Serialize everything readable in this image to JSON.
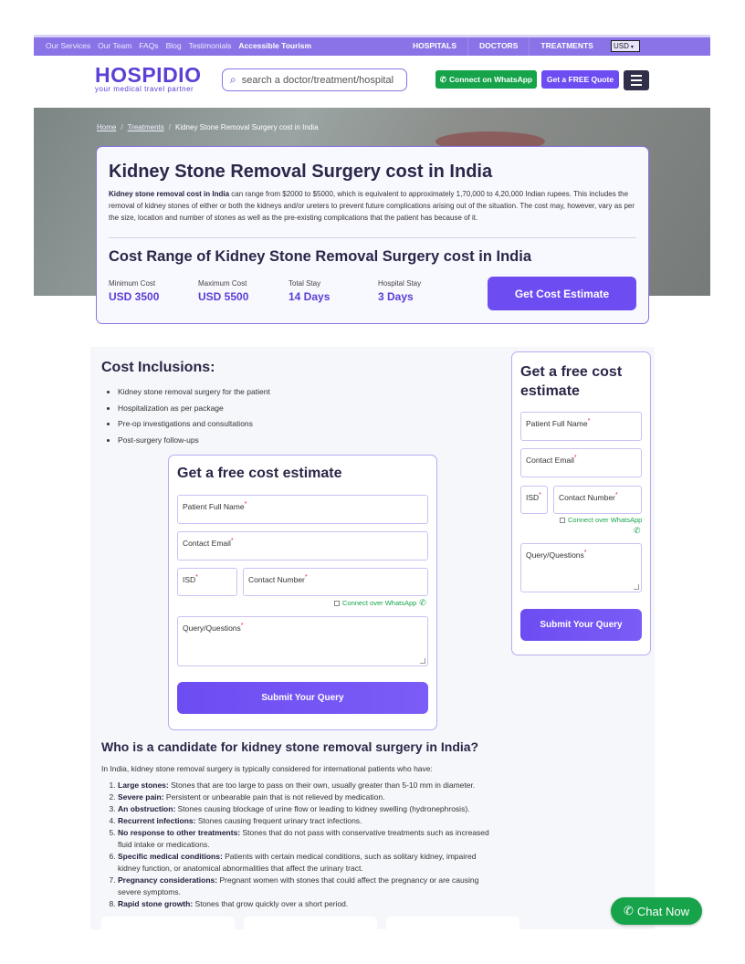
{
  "topbar": {
    "links": [
      "Our Services",
      "Our Team",
      "FAQs",
      "Blog",
      "Testimonials"
    ],
    "highlight": "Accessible Tourism",
    "menu": [
      "HOSPITALS",
      "DOCTORS",
      "TREATMENTS"
    ],
    "currency": "USD"
  },
  "header": {
    "brand": "HOSPIDIO",
    "tagline": "your medical travel partner",
    "search_placeholder": "search a doctor/treatment/hospital",
    "whatsapp_label": "Connect on WhatsApp",
    "quote_label": "Get a FREE Quote"
  },
  "breadcrumb": {
    "home": "Home",
    "treatments": "Treatments",
    "current": "Kidney Stone Removal Surgery cost in India"
  },
  "cost": {
    "title": "Kidney Stone Removal Surgery cost in India",
    "desc_bold": "Kidney stone removal cost in India",
    "desc_rest": " can range from $2000 to $5000, which is equivalent to approximately 1,70,000 to 4,20,000 Indian rupees. This includes the removal of kidney stones of either or both the kidneys and/or ureters to prevent future complications arising out of the situation. The cost may, however, vary as per the size, location and number of stones as well as the pre-existing complications that the patient has because of it.",
    "range_title": "Cost Range of Kidney Stone Removal Surgery cost in India",
    "stats": [
      {
        "label": "Minimum Cost",
        "value": "USD 3500"
      },
      {
        "label": "Maximum Cost",
        "value": "USD 5500"
      },
      {
        "label": "Total Stay",
        "value": "14 Days"
      },
      {
        "label": "Hospital Stay",
        "value": "3 Days"
      }
    ],
    "estimate_button": "Get Cost Estimate"
  },
  "inclusions": {
    "title": "Cost Inclusions:",
    "items": [
      "Kidney stone removal surgery for the patient",
      "Hospitalization as per package",
      "Pre-op investigations and consultations",
      "Post-surgery follow-ups"
    ]
  },
  "form": {
    "title": "Get a free cost estimate",
    "name": "Patient Full Name",
    "email": "Contact Email",
    "isd": "ISD",
    "number": "Contact Number",
    "whatsapp": "Connect over WhatsApp",
    "query": "Query/Questions",
    "submit": "Submit Your Query",
    "required_mark": "*"
  },
  "candidate": {
    "title": "Who is a candidate for kidney stone removal surgery in India?",
    "intro": "In India, kidney stone removal surgery is typically considered for international patients who have:",
    "items": [
      {
        "term": "Large stones:",
        "text": " Stones that are too large to pass on their own, usually greater than 5-10 mm in diameter."
      },
      {
        "term": "Severe pain:",
        "text": " Persistent or unbearable pain that is not relieved by medication."
      },
      {
        "term": "An obstruction:",
        "text": " Stones causing blockage of urine flow or leading to kidney swelling (hydronephrosis)."
      },
      {
        "term": "Recurrent infections:",
        "text": " Stones causing frequent urinary tract infections."
      },
      {
        "term": "No response to other treatments:",
        "text": " Stones that do not pass with conservative treatments such as increased fluid intake or medications."
      },
      {
        "term": "Specific medical conditions:",
        "text": " Patients with certain medical conditions, such as solitary kidney, impaired kidney function, or anatomical abnormalities that affect the urinary tract."
      },
      {
        "term": "Pregnancy considerations:",
        "text": " Pregnant women with stones that could affect the pregnancy or are causing severe symptoms."
      },
      {
        "term": "Rapid stone growth:",
        "text": " Stones that grow quickly over a short period."
      }
    ]
  },
  "chat": {
    "label": "Chat Now"
  },
  "colors": {
    "brand": "#5b3fd6",
    "accent": "#6d4df2",
    "whatsapp": "#16a34a",
    "topbar": "#8a73e6"
  }
}
